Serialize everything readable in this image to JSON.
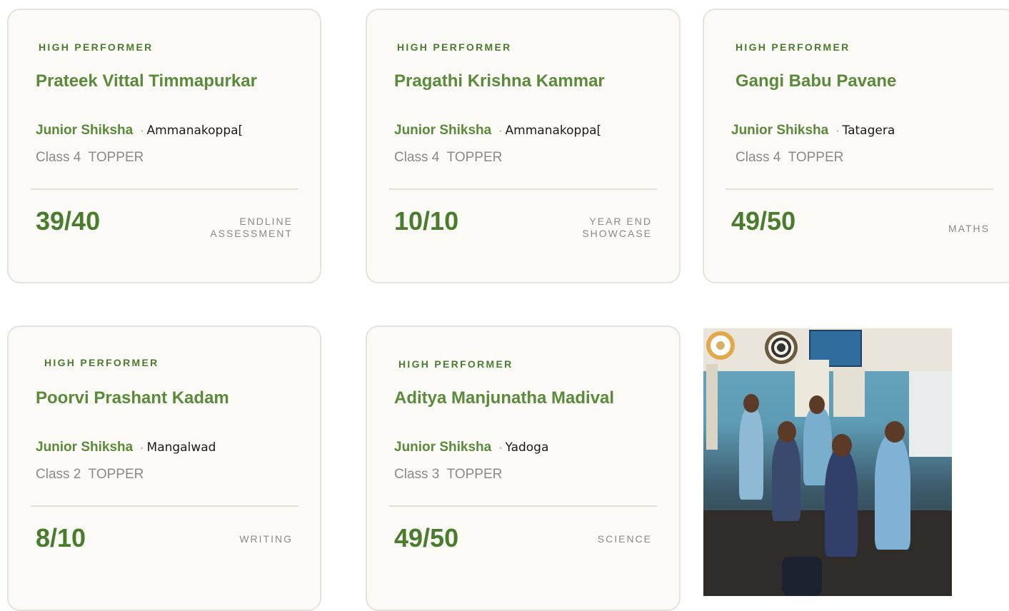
{
  "cards": [
    {
      "badge": "HIGH PERFORMER",
      "name": "Prateek Vittal Timmapurkar",
      "program": "Junior Shiksha",
      "separator": "·",
      "place": "Ammanakoppa[",
      "class_label": "Class 4  TOPPER",
      "score": "39/40",
      "category": "ENDLINE\nASSESSMENT"
    },
    {
      "badge": "HIGH PERFORMER",
      "name": "Pragathi Krishna Kammar",
      "program": "Junior Shiksha",
      "separator": "·",
      "place": "Ammanakoppa[",
      "class_label": "Class 4  TOPPER",
      "score": "10/10",
      "category": "YEAR END\nSHOWCASE"
    },
    {
      "badge": "HIGH PERFORMER",
      "name": "Gangi Babu Pavane",
      "program": "Junior Shiksha",
      "separator": "·",
      "place": "Tatagera",
      "class_label": "Class 4  TOPPER",
      "score": "49/50",
      "category": "MATHS"
    },
    {
      "badge": "HIGH PERFORMER",
      "name": "Poorvi Prashant Kadam",
      "program": "Junior Shiksha",
      "separator": "·",
      "place": "Mangalwad",
      "class_label": "Class 2  TOPPER",
      "score": "8/10",
      "category": "WRITING"
    },
    {
      "badge": "HIGH PERFORMER",
      "name": "Aditya Manjunatha Madival",
      "program": "Junior Shiksha",
      "separator": "·",
      "place": "Yadoga",
      "class_label": "Class 3  TOPPER",
      "score": "49/50",
      "category": "SCIENCE"
    }
  ],
  "photo": {
    "description_icon": "classroom-photo"
  },
  "colors": {
    "accent": "#4a7c2e",
    "name": "#5a8a3a",
    "muted": "#8a8a8a",
    "card_bg": "#fbfaf6",
    "border": "#e6e3dc"
  }
}
